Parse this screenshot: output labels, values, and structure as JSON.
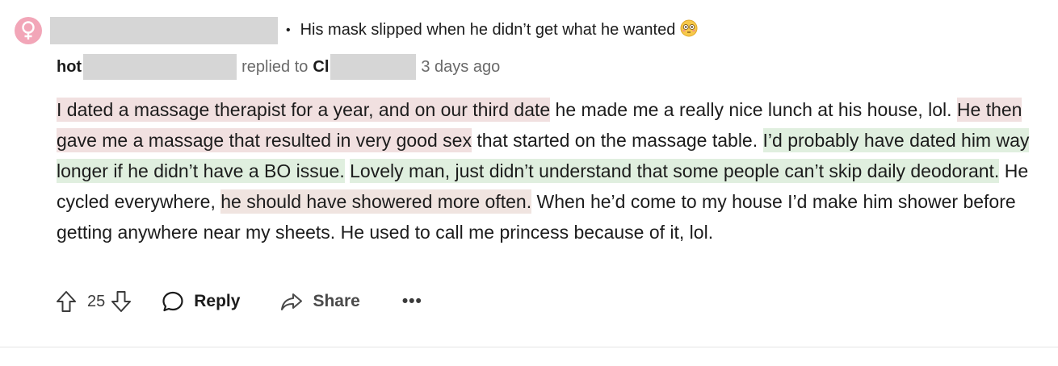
{
  "parent": {
    "avatar_icon": "female-symbol-icon",
    "avatar_color": "#f2a6b8",
    "separator": "•",
    "text": "His mask slipped when he didn’t get what he wanted",
    "emoji_icon": "flushed-face-emoji-icon"
  },
  "reply_meta": {
    "author_prefix": "hot",
    "replied_to_label": "replied to",
    "recipient_prefix": "Cl",
    "timestamp": "3 days ago"
  },
  "comment": {
    "seg1_pink": "I dated a massage therapist for a year, and on our third date",
    "seg2": " he made me a really nice lunch at his house, lol. ",
    "seg3_pink": "He then gave me a massage that resulted in very good sex",
    "seg4": " that started on the massage table. ",
    "seg5_green": "I’d probably have dated him way longer if he didn’t have a BO issue.",
    "seg6": " ",
    "seg7_green": "Lovely man, just didn’t understand that some people can’t skip daily deodorant.",
    "seg8": " He cycled everywhere, ",
    "seg9_tan": "he should have showered more often.",
    "seg10": " When he’d come to my house I’d make him shower before getting anywhere near my sheets. He used to call me princess because of it, lol."
  },
  "actions": {
    "upvote_icon": "upvote-arrow-icon",
    "vote_count": "25",
    "downvote_icon": "downvote-arrow-icon",
    "reply_label": "Reply",
    "reply_icon": "speech-bubble-icon",
    "share_label": "Share",
    "share_icon": "share-arrow-icon",
    "more_label": "•••"
  },
  "colors": {
    "highlight_pink": "#f1e0e0",
    "highlight_green": "#e0efdf",
    "highlight_tan": "#f0e4e0",
    "redaction": "#d6d6d6"
  }
}
